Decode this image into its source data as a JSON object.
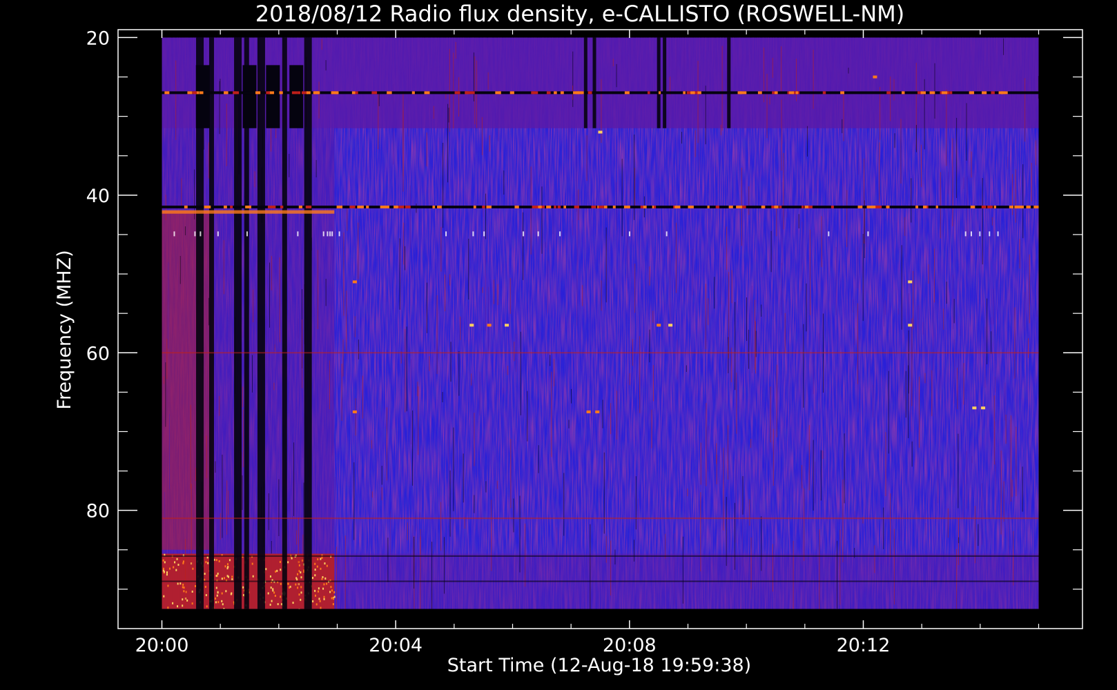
{
  "chart_data": {
    "type": "heatmap",
    "title": "2018/08/12  Radio flux density, e-CALLISTO (ROSWELL-NM)",
    "xlabel": "Start Time (12-Aug-18 19:59:38)",
    "ylabel": "Frequency (MHZ)",
    "x_ticks": [
      "20:00",
      "20:04",
      "20:08",
      "20:12"
    ],
    "x_tick_minutes": [
      0,
      4,
      8,
      12
    ],
    "x_range_minutes": [
      -0.75,
      15.75
    ],
    "data_x_range_minutes": [
      0,
      15
    ],
    "y_ticks": [
      20,
      40,
      60,
      80
    ],
    "y_minor_ticks": [
      25,
      30,
      35,
      45,
      50,
      55,
      65,
      70,
      75,
      85,
      90
    ],
    "ylim": [
      19,
      95
    ],
    "data_y_range_mhz": [
      20,
      92.5
    ],
    "y_inverted": true,
    "colors": {
      "background": "#000000",
      "axes": "#ffffff",
      "blue": "#2a1fd8",
      "purple": "#5a1aa8",
      "red": "#c0201a",
      "orange": "#ff7a1a",
      "yellow": "#ffd060",
      "dark": "#05030f"
    },
    "features": {
      "interference_band_mhz": [
        20,
        31.5
      ],
      "early_noisy_period_minutes": [
        0,
        2.95
      ],
      "strong_lines_mhz": [
        27,
        41.5
      ],
      "weak_lines_mhz": [
        60,
        81
      ],
      "high_freq_noise_band_mhz": [
        85.5,
        92.5
      ],
      "dark_streak_minutes": [
        0.65,
        0.85,
        1.3,
        1.45,
        1.7,
        2.1,
        2.5,
        7.25,
        7.4,
        8.5,
        8.6,
        9.7
      ]
    }
  }
}
